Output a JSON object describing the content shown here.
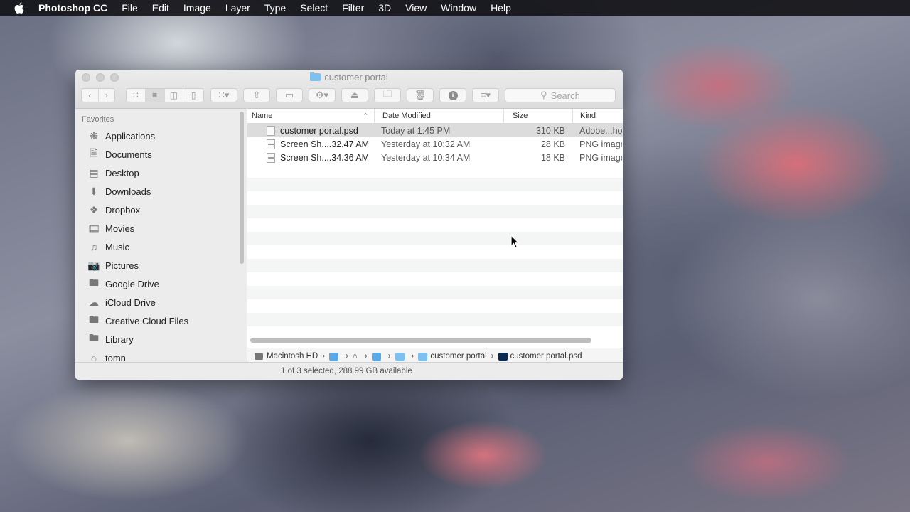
{
  "menubar": {
    "app_name": "Photoshop CC",
    "items": [
      "File",
      "Edit",
      "Image",
      "Layer",
      "Type",
      "Select",
      "Filter",
      "3D",
      "View",
      "Window",
      "Help"
    ]
  },
  "window": {
    "title": "customer portal",
    "search_placeholder": "Search"
  },
  "sidebar": {
    "heading": "Favorites",
    "items": [
      {
        "label": "Applications",
        "icon": "applications-icon"
      },
      {
        "label": "Documents",
        "icon": "documents-icon"
      },
      {
        "label": "Desktop",
        "icon": "desktop-icon"
      },
      {
        "label": "Downloads",
        "icon": "downloads-icon"
      },
      {
        "label": "Dropbox",
        "icon": "dropbox-icon"
      },
      {
        "label": "Movies",
        "icon": "movies-icon"
      },
      {
        "label": "Music",
        "icon": "music-icon"
      },
      {
        "label": "Pictures",
        "icon": "pictures-icon"
      },
      {
        "label": "Google Drive",
        "icon": "folder-icon"
      },
      {
        "label": "iCloud Drive",
        "icon": "cloud-icon"
      },
      {
        "label": "Creative Cloud Files",
        "icon": "folder-icon"
      },
      {
        "label": "Library",
        "icon": "folder-icon"
      },
      {
        "label": "tomn",
        "icon": "home-icon"
      }
    ]
  },
  "list": {
    "columns": {
      "name": "Name",
      "date": "Date Modified",
      "size": "Size",
      "kind": "Kind"
    },
    "files": [
      {
        "name": "customer portal.psd",
        "date": "Today at 1:45 PM",
        "size": "310 KB",
        "kind": "Adobe...hop"
      },
      {
        "name": "Screen Sh....32.47 AM",
        "date": "Yesterday at 10:32 AM",
        "size": "28 KB",
        "kind": "PNG image"
      },
      {
        "name": "Screen Sh....34.36 AM",
        "date": "Yesterday at 10:34 AM",
        "size": "18 KB",
        "kind": "PNG image"
      }
    ]
  },
  "pathbar": {
    "root": "Macintosh HD",
    "folder": "customer portal",
    "file": "customer portal.psd"
  },
  "status": "1 of 3 selected, 288.99 GB available"
}
